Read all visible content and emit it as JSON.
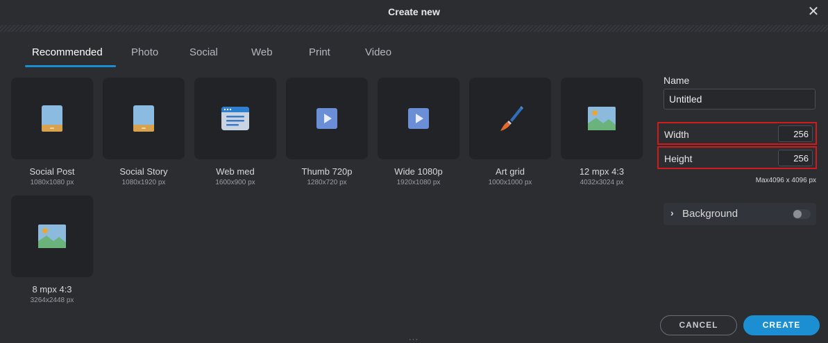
{
  "window": {
    "title": "Create new",
    "close_icon": "close-icon"
  },
  "tabs": [
    {
      "label": "Recommended",
      "active": true
    },
    {
      "label": "Photo",
      "active": false
    },
    {
      "label": "Social",
      "active": false
    },
    {
      "label": "Web",
      "active": false
    },
    {
      "label": "Print",
      "active": false
    },
    {
      "label": "Video",
      "active": false
    }
  ],
  "presets": [
    {
      "name": "Social Post",
      "dims": "1080x1080 px",
      "icon": "phone-icon"
    },
    {
      "name": "Social Story",
      "dims": "1080x1920 px",
      "icon": "phone-icon"
    },
    {
      "name": "Web med",
      "dims": "1600x900 px",
      "icon": "browser-window-icon"
    },
    {
      "name": "Thumb 720p",
      "dims": "1280x720 px",
      "icon": "play-icon"
    },
    {
      "name": "Wide 1080p",
      "dims": "1920x1080 px",
      "icon": "play-icon"
    },
    {
      "name": "Art grid",
      "dims": "1000x1000 px",
      "icon": "paintbrush-icon"
    },
    {
      "name": "12 mpx 4:3",
      "dims": "4032x3024 px",
      "icon": "landscape-image-icon"
    },
    {
      "name": "8 mpx 4:3",
      "dims": "3264x2448 px",
      "icon": "landscape-image-icon"
    }
  ],
  "panel": {
    "name_label": "Name",
    "name_value": "Untitled",
    "width_label": "Width",
    "width_value": "256",
    "height_label": "Height",
    "height_value": "256",
    "max_note": "Max4096 x 4096 px",
    "background_label": "Background",
    "background_enabled": false
  },
  "buttons": {
    "cancel": "CANCEL",
    "create": "CREATE"
  },
  "colors": {
    "accent": "#1b8fd2",
    "highlight_border": "#d11a1a",
    "background": "#2b2d31",
    "card": "#212327"
  }
}
